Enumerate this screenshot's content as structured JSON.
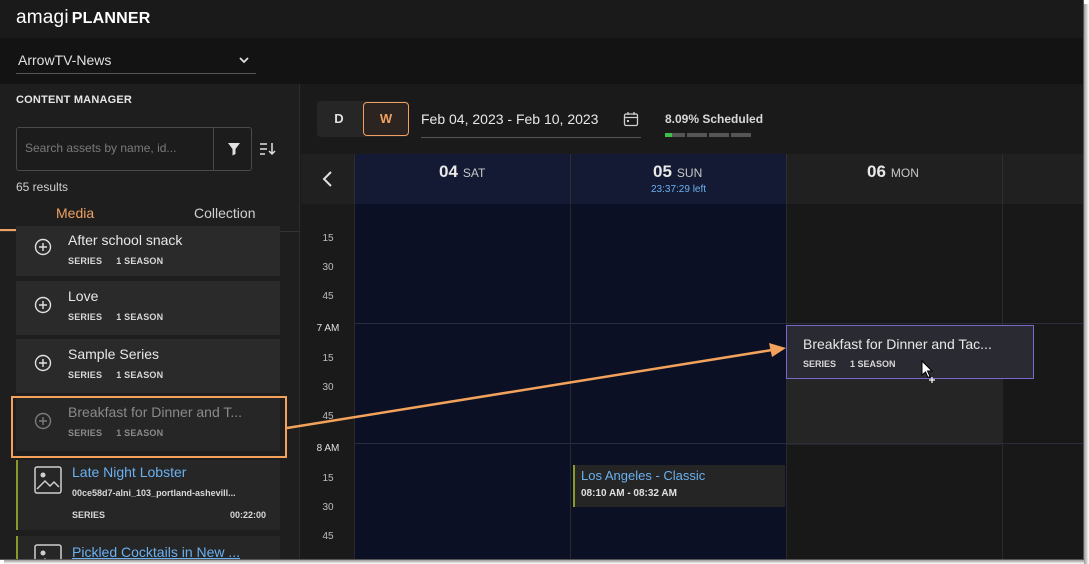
{
  "app": {
    "brand": "amagi",
    "product": "PLANNER"
  },
  "channel": {
    "selected": "ArrowTV-News"
  },
  "content_manager": {
    "title": "CONTENT MANAGER",
    "search_placeholder": "Search assets by name, id...",
    "results": "65 results",
    "tabs": [
      "Media",
      "Collection"
    ],
    "series_items": [
      {
        "title": "After school snack",
        "type": "SERIES",
        "seasons": "1 SEASON"
      },
      {
        "title": "Love",
        "type": "SERIES",
        "seasons": "1 SEASON"
      },
      {
        "title": "Sample Series",
        "type": "SERIES",
        "seasons": "1 SEASON"
      },
      {
        "title": "Breakfast for Dinner and T...",
        "type": "SERIES",
        "seasons": "1 SEASON"
      }
    ],
    "asset_items": [
      {
        "title": "Late Night Lobster",
        "id": "00ce58d7-alni_103_portland-ashevill...",
        "type": "SERIES",
        "duration": "00:22:00"
      },
      {
        "title": "Pickled Cocktails in New ..."
      }
    ]
  },
  "toolbar": {
    "view_day": "D",
    "view_week": "W",
    "date_range": "Feb 04, 2023 - Feb 10, 2023",
    "scheduled": "8.09% Scheduled",
    "scheduled_fraction": 0.0809
  },
  "calendar": {
    "days": [
      {
        "num": "04",
        "name": "SAT",
        "note": ""
      },
      {
        "num": "05",
        "name": "SUN",
        "note": "23:37:29 left"
      },
      {
        "num": "06",
        "name": "MON",
        "note": ""
      }
    ],
    "time_labels": [
      "15",
      "30",
      "45",
      "7 AM",
      "15",
      "30",
      "45",
      "8 AM",
      "15",
      "30",
      "45"
    ],
    "event": {
      "title": "Los Angeles - Classic",
      "time": "08:10 AM - 08:32 AM"
    },
    "drag_preview": {
      "title": "Breakfast for Dinner and Tac...",
      "type": "SERIES",
      "seasons": "1 SEASON"
    }
  },
  "colors": {
    "accent": "#f0a060",
    "link": "#6ab0f0",
    "highlight": "#f3a25b",
    "drop_border": "#7a68c8"
  }
}
